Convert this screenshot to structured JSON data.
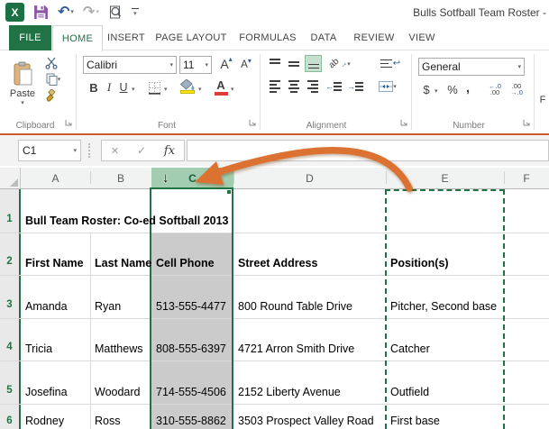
{
  "window": {
    "title": "Bulls Sotfball Team Roster -"
  },
  "tabs": {
    "file": "FILE",
    "home": "HOME",
    "insert": "INSERT",
    "page_layout": "PAGE LAYOUT",
    "formulas": "FORMULAS",
    "data": "DATA",
    "review": "REVIEW",
    "view": "VIEW"
  },
  "ribbon": {
    "clipboard": {
      "paste": "Paste",
      "label": "Clipboard"
    },
    "font": {
      "name": "Calibri",
      "size": "11",
      "bold": "B",
      "italic": "I",
      "underline": "U",
      "grow": "A",
      "shrink": "A",
      "color_a": "A",
      "label": "Font"
    },
    "alignment": {
      "orientation": "ab",
      "label": "Alignment"
    },
    "number": {
      "format": "General",
      "currency": "$",
      "percent": "%",
      "comma": ",",
      "inc_top": "←.0",
      "inc_bot": ".00",
      "dec_top": ".00",
      "dec_bot": "→.0",
      "label": "Number"
    },
    "partial_group": "F"
  },
  "formula_bar": {
    "name_box": "C1",
    "fx_label": "fx",
    "value": ""
  },
  "sheet": {
    "column_headers": [
      "A",
      "B",
      "C",
      "D",
      "E",
      "F"
    ],
    "row_headers": [
      "1",
      "2",
      "3",
      "4",
      "5",
      "6"
    ],
    "cells": {
      "a1": "Bull Team Roster: Co-ed Softball 2013",
      "a2": "First Name",
      "b2": "Last Name",
      "c2": "Cell Phone",
      "d2": "Street Address",
      "e2": "Position(s)",
      "a3": "Amanda",
      "b3": "Ryan",
      "c3": "513-555-4477",
      "d3": "800 Round Table Drive",
      "e3": "Pitcher, Second base",
      "a4": "Tricia",
      "b4": "Matthews",
      "c4": "808-555-6397",
      "d4": "4721 Arron Smith Drive",
      "e4": "Catcher",
      "a5": "Josefina",
      "b5": "Woodard",
      "c5": "714-555-4506",
      "d5": "2152 Liberty Avenue",
      "e5": "Outfield",
      "a6": "Rodney",
      "b6": "Ross",
      "c6": "310-555-8862",
      "d6": "3503 Prospect Valley Road",
      "e6": "First base"
    }
  },
  "colors": {
    "excel_green": "#217346",
    "selected_header_green": "#a3cdb0",
    "selection_gray": "#cbcbcb",
    "marching_ants_green": "#1e7145",
    "annotation_arrow_orange": "#dc7232"
  }
}
